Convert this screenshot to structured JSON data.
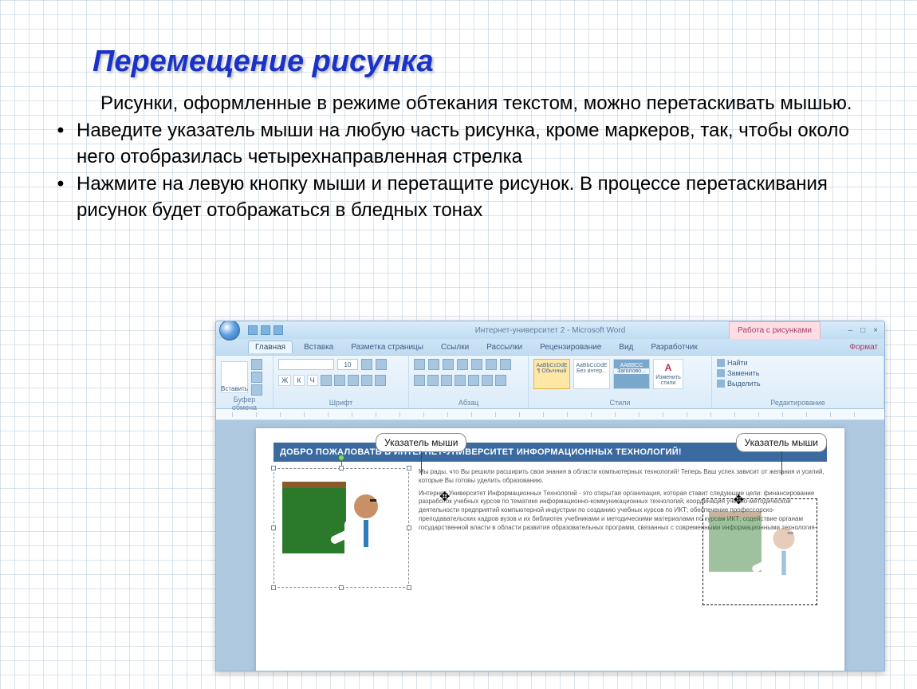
{
  "slide": {
    "title": "Перемещение рисунка",
    "para1": "Рисунки, оформленные в режиме обтекания текстом, можно перетаскивать мышью.",
    "bullet1": "Наведите указатель мыши на любую часть рисунка, кроме маркеров, так, чтобы около него отобразилась четырехнаправленная стрелка",
    "bullet2": "Нажмите на левую кнопку мыши и перетащите рисунок. В процессе перетаскивания рисунок будет отображаться в бледных тонах",
    "bullet_symbol": "•"
  },
  "word": {
    "doc_title": "Интернет-университет 2 - Microsoft Word",
    "contextual_tab_title": "Работа с рисунками",
    "window_buttons": {
      "min": "–",
      "max": "□",
      "close": "×"
    },
    "tabs": [
      "Главная",
      "Вставка",
      "Разметка страницы",
      "Ссылки",
      "Рассылки",
      "Рецензирование",
      "Вид",
      "Разработчик"
    ],
    "contextual_tab": "Формат",
    "ribbon": {
      "clipboard": {
        "label": "Буфер обмена",
        "paste": "Вставить"
      },
      "font": {
        "label": "Шрифт",
        "size": "10",
        "bold": "Ж",
        "italic": "К",
        "under": "Ч"
      },
      "paragraph": {
        "label": "Абзац"
      },
      "styles": {
        "label": "Стили",
        "items": [
          {
            "sample": "AaBbCcDdE",
            "name": "¶ Обычный"
          },
          {
            "sample": "AaBbCcDdE",
            "name": "Без интер..."
          },
          {
            "sample": "AABBCC",
            "name": "Заголово..."
          }
        ],
        "change": "Изменить стили"
      },
      "editing": {
        "label": "Редактирование",
        "find": "Найти",
        "replace": "Заменить",
        "select": "Выделить"
      }
    },
    "callout_left": "Указатель мыши",
    "callout_right": "Указатель мыши",
    "banner": "ДОБРО ПОЖАЛОВАТЬ В ИНТЕРНЕТ-УНИВЕРСИТЕТ ИНФОРМАЦИОННЫХ ТЕХНОЛОГИЙ!",
    "bodytext": {
      "p1": "Мы рады, что Вы решили расширить свои знания в области компьютерных технологий! Теперь Ваш успех зависит от желания и усилий, которые Вы готовы уделить образованию.",
      "p2": "Интернет-Университет Информационных Технологий - это открытая организация, которая ставит следующие цели: финансирование разработок учебных курсов по тематике информационно-коммуникационных технологий; координация учебно-методической деятельности предприятий компьютерной индустрии по созданию учебных курсов по ИКТ; обеспечение профессорско-преподавательских кадров вузов и их библиотек учебниками и методическими материалами по курсам ИКТ; содействие органам государственной власти в области развития образовательных программ, связанных с современными информационными технология-"
    }
  }
}
